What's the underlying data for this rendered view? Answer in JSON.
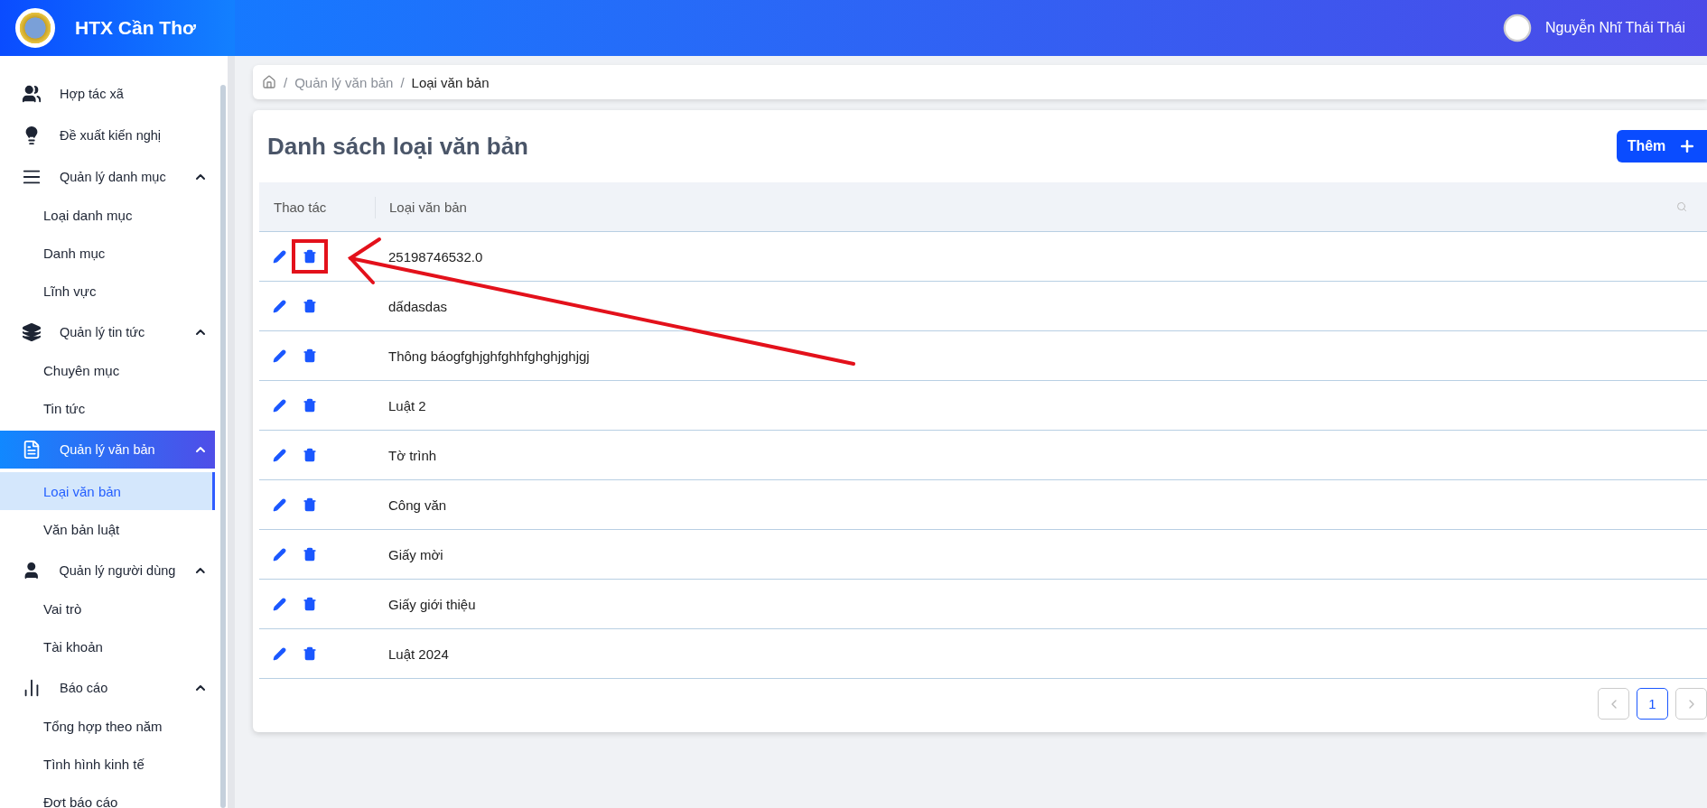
{
  "app": {
    "title": "HTX Cần Thơ"
  },
  "user": {
    "name": "Nguyễn Nhĩ Thái Thái"
  },
  "sidebar": {
    "items": [
      {
        "kind": "link",
        "label": "Hợp tác xã",
        "active": false
      },
      {
        "kind": "link",
        "label": "Đề xuất kiến nghị",
        "active": false
      },
      {
        "kind": "group",
        "label": "Quản lý danh mục",
        "active": false,
        "expanded": true,
        "children": [
          {
            "label": "Loại danh mục",
            "selected": false
          },
          {
            "label": "Danh mục",
            "selected": false
          },
          {
            "label": "Lĩnh vực",
            "selected": false
          }
        ]
      },
      {
        "kind": "group",
        "label": "Quản lý tin tức",
        "active": false,
        "expanded": true,
        "children": [
          {
            "label": "Chuyên mục",
            "selected": false
          },
          {
            "label": "Tin tức",
            "selected": false
          }
        ]
      },
      {
        "kind": "group",
        "label": "Quản lý văn bản",
        "active": true,
        "expanded": true,
        "children": [
          {
            "label": "Loại văn bản",
            "selected": true
          },
          {
            "label": "Văn bản luật",
            "selected": false
          }
        ]
      },
      {
        "kind": "group",
        "label": "Quản lý người dùng",
        "active": false,
        "expanded": true,
        "children": [
          {
            "label": "Vai trò",
            "selected": false
          },
          {
            "label": "Tài khoản",
            "selected": false
          }
        ]
      },
      {
        "kind": "group",
        "label": "Báo cáo",
        "active": false,
        "expanded": true,
        "children": [
          {
            "label": "Tổng hợp theo năm",
            "selected": false
          },
          {
            "label": "Tình hình kinh tế",
            "selected": false
          },
          {
            "label": "Đợt báo cáo",
            "selected": false
          }
        ]
      }
    ]
  },
  "breadcrumb": {
    "separator": "/",
    "items": [
      "Quản lý văn bản",
      "Loại văn bản"
    ]
  },
  "page": {
    "title": "Danh sách loại văn bản",
    "add_button": "Thêm"
  },
  "table": {
    "columns": [
      "Thao tác",
      "Loại văn bản"
    ],
    "rows": [
      {
        "name": "25198746532.0",
        "highlighted": true
      },
      {
        "name": "dấdasdas",
        "highlighted": false
      },
      {
        "name": "Thông báogfghjghfghhfghghjghjgj",
        "highlighted": false
      },
      {
        "name": "Luật 2",
        "highlighted": false
      },
      {
        "name": "Tờ trình",
        "highlighted": false
      },
      {
        "name": "Công văn",
        "highlighted": false
      },
      {
        "name": "Giấy mời",
        "highlighted": false
      },
      {
        "name": "Giấy giới thiệu",
        "highlighted": false
      },
      {
        "name": "Luật 2024",
        "highlighted": false
      }
    ]
  },
  "pagination": {
    "pages": [
      {
        "label": "1",
        "selected": true
      }
    ]
  }
}
